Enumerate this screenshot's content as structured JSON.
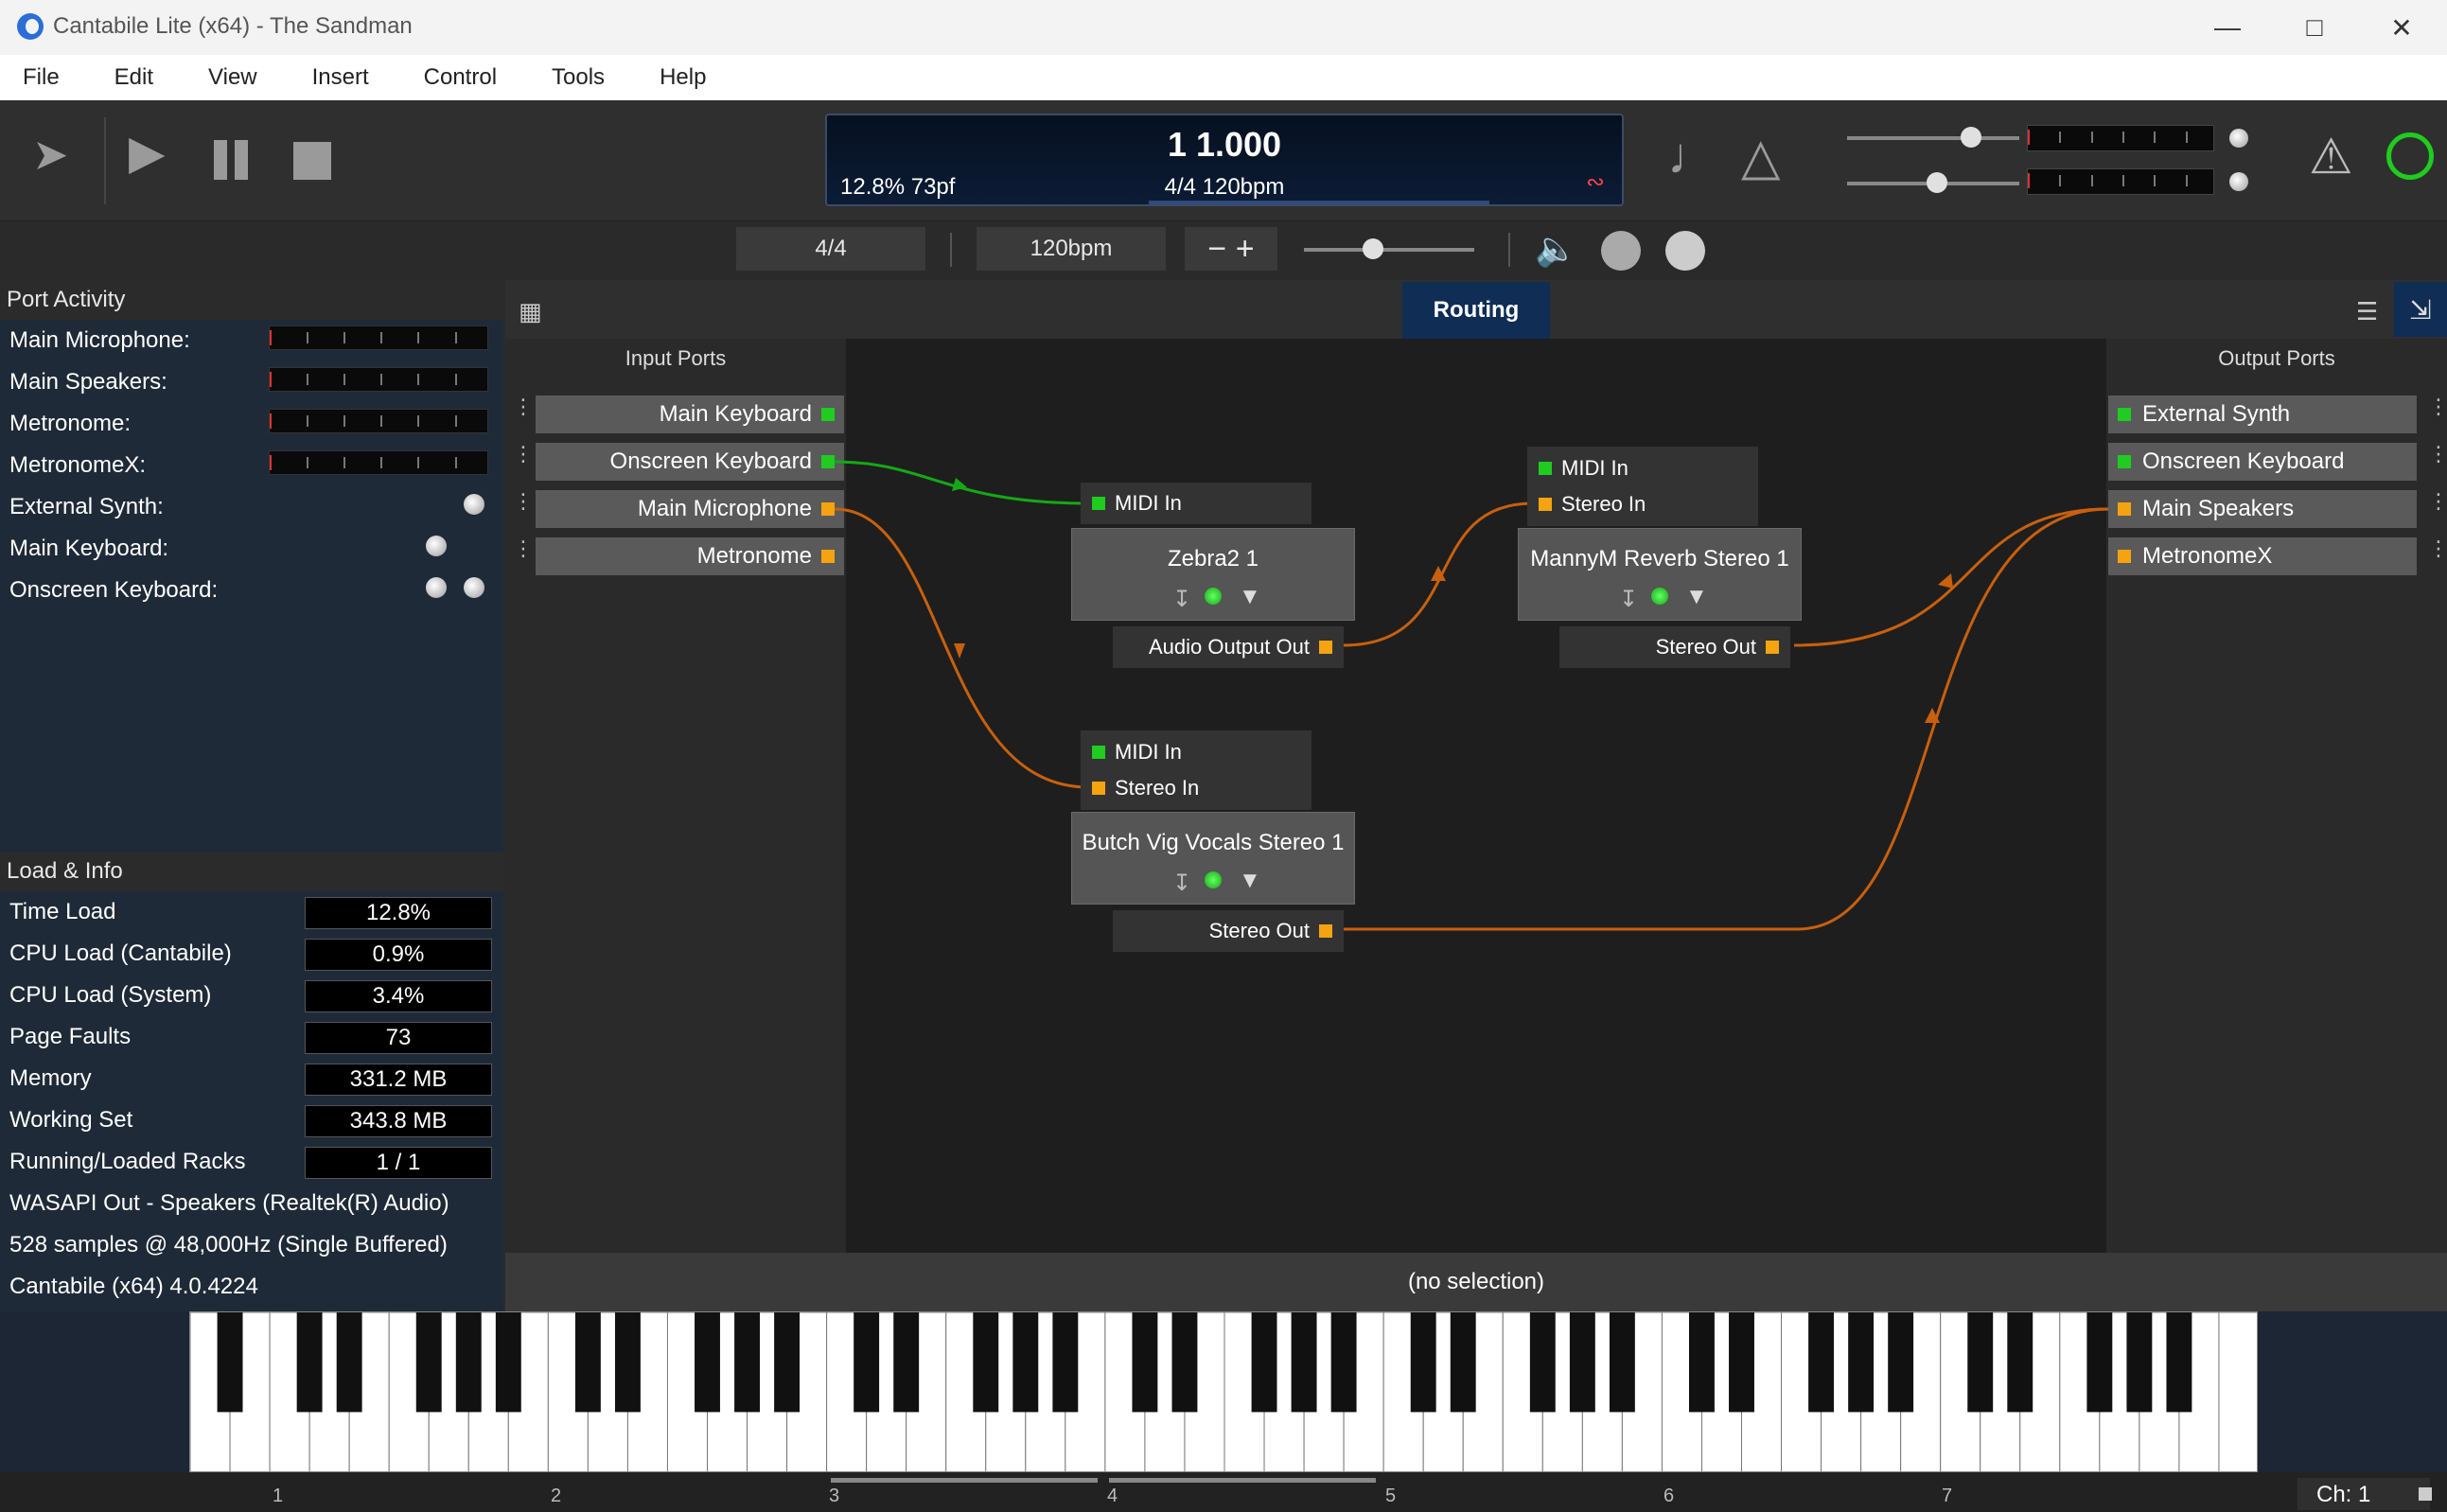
{
  "window": {
    "title": "Cantabile Lite (x64) - The Sandman"
  },
  "menu": [
    "File",
    "Edit",
    "View",
    "Insert",
    "Control",
    "Tools",
    "Help"
  ],
  "display": {
    "position": "1 1.000",
    "load": "12.8%  73pf",
    "tempo": "4/4 120bpm"
  },
  "transport": {
    "time_sig": "4/4",
    "bpm": "120bpm"
  },
  "port_activity": {
    "title": "Port Activity",
    "rows": [
      "Main Microphone:",
      "Main Speakers:",
      "Metronome:",
      "MetronomeX:",
      "External Synth:",
      "Main Keyboard:",
      "Onscreen Keyboard:"
    ]
  },
  "load_info": {
    "title": "Load & Info",
    "rows": [
      {
        "label": "Time Load",
        "value": "12.8%"
      },
      {
        "label": "CPU Load (Cantabile)",
        "value": "0.9%"
      },
      {
        "label": "CPU Load (System)",
        "value": "3.4%"
      },
      {
        "label": "Page Faults",
        "value": "73"
      },
      {
        "label": "Memory",
        "value": "331.2 MB"
      },
      {
        "label": "Working Set",
        "value": "343.8 MB"
      },
      {
        "label": "Running/Loaded Racks",
        "value": "1 / 1"
      }
    ],
    "lines": [
      "WASAPI Out - Speakers (Realtek(R) Audio)",
      "528 samples @ 48,000Hz (Single Buffered)",
      "Cantabile (x64) 4.0.4224"
    ]
  },
  "routing": {
    "tab": "Routing",
    "input_header": "Input Ports",
    "output_header": "Output Ports",
    "inputs": [
      "Main Keyboard",
      "Onscreen Keyboard",
      "Main Microphone",
      "Metronome"
    ],
    "outputs": [
      "External Synth",
      "Onscreen Keyboard",
      "Main Speakers",
      "MetronomeX"
    ],
    "nodes": {
      "zebra": {
        "name": "Zebra2 1",
        "in1": "MIDI In",
        "out": "Audio Output Out"
      },
      "manny": {
        "name": "MannyM Reverb Stereo 1",
        "in1": "MIDI In",
        "in2": "Stereo In",
        "out": "Stereo Out"
      },
      "butch": {
        "name": "Butch Vig Vocals Stereo 1",
        "in1": "MIDI In",
        "in2": "Stereo In",
        "out": "Stereo Out"
      }
    },
    "selection": "(no selection)"
  },
  "keyboard": {
    "octaves": [
      "1",
      "2",
      "3",
      "4",
      "5",
      "6",
      "7"
    ],
    "channel": "Ch: 1"
  },
  "colors": {
    "midi": "#1fcc1f",
    "audio": "#f5a30f",
    "wire_audio": "#c8600e",
    "wire_midi": "#15a815",
    "accent": "#0f2d55",
    "power": "#1fcc1f"
  }
}
